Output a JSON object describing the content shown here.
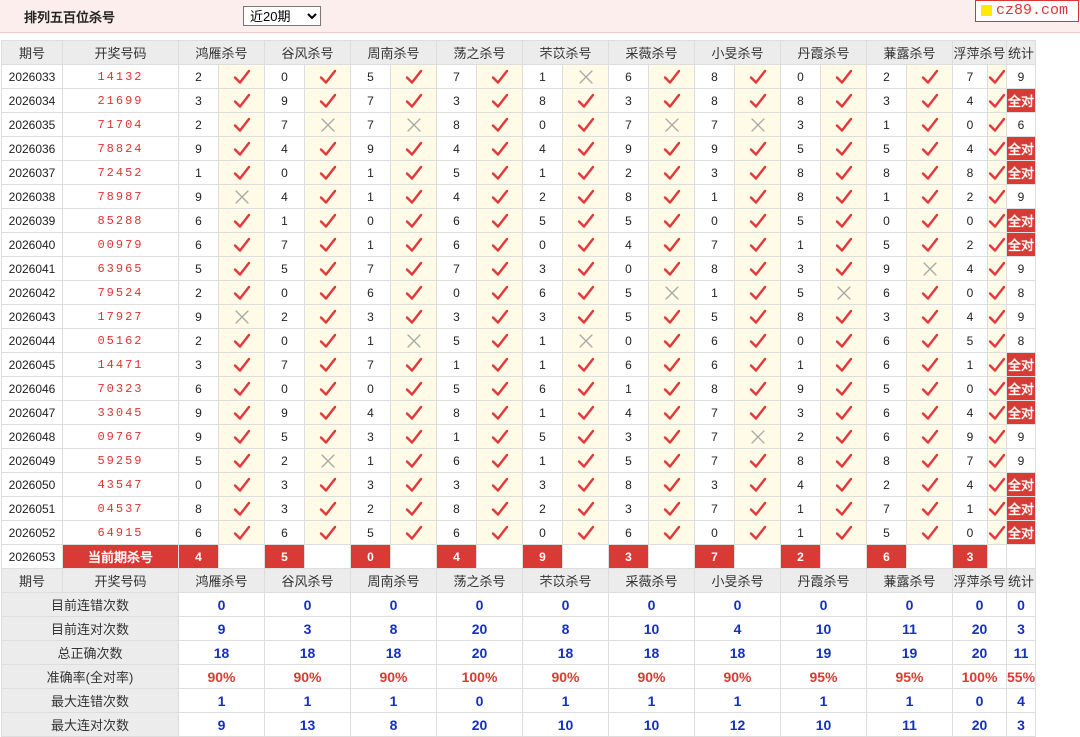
{
  "page": {
    "title": "排列五百位杀号",
    "select_value": "近20期",
    "site": "cz89.com"
  },
  "header": [
    "期号",
    "开奖号码",
    "鸿雁杀号",
    "谷风杀号",
    "周南杀号",
    "荡之杀号",
    "芣苡杀号",
    "采薇杀号",
    "小旻杀号",
    "丹霞杀号",
    "蒹露杀号",
    "浮萍杀号",
    "统计"
  ],
  "rows": [
    {
      "period": "2026033",
      "win": "14132",
      "kills": [
        2,
        0,
        5,
        7,
        1,
        6,
        8,
        0,
        2,
        7
      ],
      "hits": [
        1,
        1,
        1,
        1,
        0,
        1,
        1,
        1,
        1,
        1
      ],
      "count": "9"
    },
    {
      "period": "2026034",
      "win": "21699",
      "kills": [
        3,
        9,
        7,
        3,
        8,
        3,
        8,
        8,
        3,
        4
      ],
      "hits": [
        1,
        1,
        1,
        1,
        1,
        1,
        1,
        1,
        1,
        1
      ],
      "count": "全对"
    },
    {
      "period": "2026035",
      "win": "71704",
      "kills": [
        2,
        7,
        7,
        8,
        0,
        7,
        7,
        3,
        1,
        0
      ],
      "hits": [
        1,
        0,
        0,
        1,
        1,
        0,
        0,
        1,
        1,
        1
      ],
      "count": "6"
    },
    {
      "period": "2026036",
      "win": "78824",
      "kills": [
        9,
        4,
        9,
        4,
        4,
        9,
        9,
        5,
        5,
        4
      ],
      "hits": [
        1,
        1,
        1,
        1,
        1,
        1,
        1,
        1,
        1,
        1
      ],
      "count": "全对"
    },
    {
      "period": "2026037",
      "win": "72452",
      "kills": [
        1,
        0,
        1,
        5,
        1,
        2,
        3,
        8,
        8,
        8
      ],
      "hits": [
        1,
        1,
        1,
        1,
        1,
        1,
        1,
        1,
        1,
        1
      ],
      "count": "全对"
    },
    {
      "period": "2026038",
      "win": "78987",
      "kills": [
        9,
        4,
        1,
        4,
        2,
        8,
        1,
        8,
        1,
        2
      ],
      "hits": [
        0,
        1,
        1,
        1,
        1,
        1,
        1,
        1,
        1,
        1
      ],
      "count": "9"
    },
    {
      "period": "2026039",
      "win": "85288",
      "kills": [
        6,
        1,
        0,
        6,
        5,
        5,
        0,
        5,
        0,
        0
      ],
      "hits": [
        1,
        1,
        1,
        1,
        1,
        1,
        1,
        1,
        1,
        1
      ],
      "count": "全对"
    },
    {
      "period": "2026040",
      "win": "00979",
      "kills": [
        6,
        7,
        1,
        6,
        0,
        4,
        7,
        1,
        5,
        2
      ],
      "hits": [
        1,
        1,
        1,
        1,
        1,
        1,
        1,
        1,
        1,
        1
      ],
      "count": "全对"
    },
    {
      "period": "2026041",
      "win": "63965",
      "kills": [
        5,
        5,
        7,
        7,
        3,
        0,
        8,
        3,
        9,
        4
      ],
      "hits": [
        1,
        1,
        1,
        1,
        1,
        1,
        1,
        1,
        0,
        1
      ],
      "count": "9"
    },
    {
      "period": "2026042",
      "win": "79524",
      "kills": [
        2,
        0,
        6,
        0,
        6,
        5,
        1,
        5,
        6,
        0
      ],
      "hits": [
        1,
        1,
        1,
        1,
        1,
        0,
        1,
        0,
        1,
        1
      ],
      "count": "8"
    },
    {
      "period": "2026043",
      "win": "17927",
      "kills": [
        9,
        2,
        3,
        3,
        3,
        5,
        5,
        8,
        3,
        4
      ],
      "hits": [
        0,
        1,
        1,
        1,
        1,
        1,
        1,
        1,
        1,
        1
      ],
      "count": "9"
    },
    {
      "period": "2026044",
      "win": "05162",
      "kills": [
        2,
        0,
        1,
        5,
        1,
        0,
        6,
        0,
        6,
        5
      ],
      "hits": [
        1,
        1,
        0,
        1,
        0,
        1,
        1,
        1,
        1,
        1
      ],
      "count": "8"
    },
    {
      "period": "2026045",
      "win": "14471",
      "kills": [
        3,
        7,
        7,
        1,
        1,
        6,
        6,
        1,
        6,
        1
      ],
      "hits": [
        1,
        1,
        1,
        1,
        1,
        1,
        1,
        1,
        1,
        1
      ],
      "count": "全对"
    },
    {
      "period": "2026046",
      "win": "70323",
      "kills": [
        6,
        0,
        0,
        5,
        6,
        1,
        8,
        9,
        5,
        0
      ],
      "hits": [
        1,
        1,
        1,
        1,
        1,
        1,
        1,
        1,
        1,
        1
      ],
      "count": "全对"
    },
    {
      "period": "2026047",
      "win": "33045",
      "kills": [
        9,
        9,
        4,
        8,
        1,
        4,
        7,
        3,
        6,
        4
      ],
      "hits": [
        1,
        1,
        1,
        1,
        1,
        1,
        1,
        1,
        1,
        1
      ],
      "count": "全对"
    },
    {
      "period": "2026048",
      "win": "09767",
      "kills": [
        9,
        5,
        3,
        1,
        5,
        3,
        7,
        2,
        6,
        9
      ],
      "hits": [
        1,
        1,
        1,
        1,
        1,
        1,
        0,
        1,
        1,
        1
      ],
      "count": "9"
    },
    {
      "period": "2026049",
      "win": "59259",
      "kills": [
        5,
        2,
        1,
        6,
        1,
        5,
        7,
        8,
        8,
        7
      ],
      "hits": [
        1,
        0,
        1,
        1,
        1,
        1,
        1,
        1,
        1,
        1
      ],
      "count": "9"
    },
    {
      "period": "2026050",
      "win": "43547",
      "kills": [
        0,
        3,
        3,
        3,
        3,
        8,
        3,
        4,
        2,
        4
      ],
      "hits": [
        1,
        1,
        1,
        1,
        1,
        1,
        1,
        1,
        1,
        1
      ],
      "count": "全对"
    },
    {
      "period": "2026051",
      "win": "04537",
      "kills": [
        8,
        3,
        2,
        8,
        2,
        3,
        7,
        1,
        7,
        1
      ],
      "hits": [
        1,
        1,
        1,
        1,
        1,
        1,
        1,
        1,
        1,
        1
      ],
      "count": "全对"
    },
    {
      "period": "2026052",
      "win": "64915",
      "kills": [
        6,
        6,
        5,
        6,
        0,
        6,
        0,
        1,
        5,
        0
      ],
      "hits": [
        1,
        1,
        1,
        1,
        1,
        1,
        1,
        1,
        1,
        1
      ],
      "count": "全对"
    }
  ],
  "current": {
    "period": "2026053",
    "label": "当前期杀号",
    "kills": [
      4,
      5,
      0,
      4,
      9,
      3,
      7,
      2,
      6,
      3
    ]
  },
  "stats": [
    {
      "label": "目前连错次数",
      "values": [
        "0",
        "0",
        "0",
        "0",
        "0",
        "0",
        "0",
        "0",
        "0",
        "0"
      ],
      "total": "0"
    },
    {
      "label": "目前连对次数",
      "values": [
        "9",
        "3",
        "8",
        "20",
        "8",
        "10",
        "4",
        "10",
        "11",
        "20"
      ],
      "total": "3"
    },
    {
      "label": "总正确次数",
      "values": [
        "18",
        "18",
        "18",
        "20",
        "18",
        "18",
        "18",
        "19",
        "19",
        "20"
      ],
      "total": "11"
    },
    {
      "label": "准确率(全对率)",
      "values": [
        "90%",
        "90%",
        "90%",
        "100%",
        "90%",
        "90%",
        "90%",
        "95%",
        "95%",
        "100%"
      ],
      "total": "55%",
      "red": true
    },
    {
      "label": "最大连错次数",
      "values": [
        "1",
        "1",
        "1",
        "0",
        "1",
        "1",
        "1",
        "1",
        "1",
        "0"
      ],
      "total": "4"
    },
    {
      "label": "最大连对次数",
      "values": [
        "9",
        "13",
        "8",
        "20",
        "10",
        "10",
        "12",
        "10",
        "11",
        "20"
      ],
      "total": "3"
    }
  ],
  "colors": {
    "accent": "#d93a35",
    "stat_blue": "#1530c0",
    "mark_bg": "#fffbe6",
    "header_bg": "#ececec"
  },
  "icons": {
    "hit": "check-icon",
    "miss": "cross-icon"
  }
}
